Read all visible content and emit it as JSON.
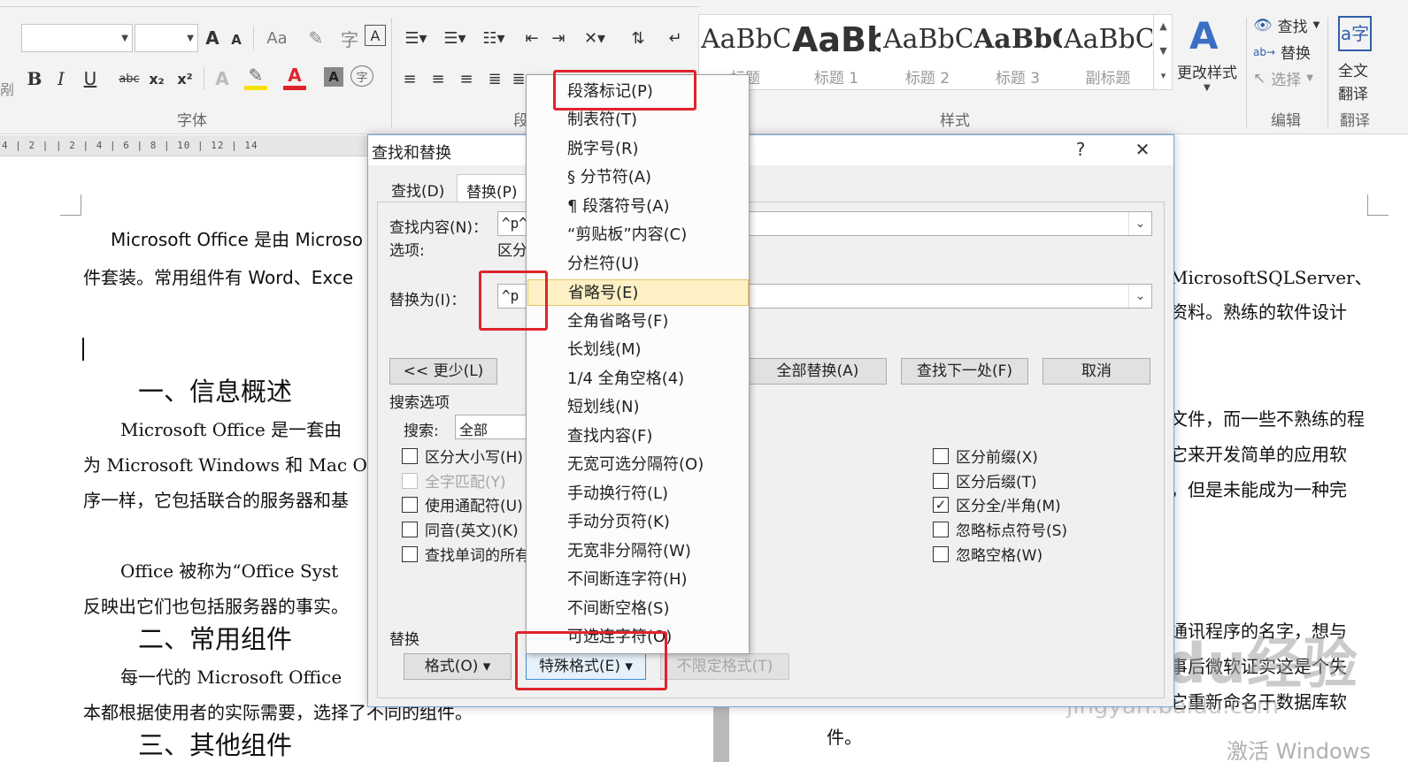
{
  "ribbon": {
    "font_group_label": "字体",
    "para_group_label": "段",
    "styles_group_label": "样式",
    "edit_group_label": "编辑",
    "translate_group_label": "翻译",
    "font_buttons": {
      "grow": "A",
      "shrink": "A",
      "aa": "Aa",
      "bold": "B",
      "italic": "I",
      "underline": "U",
      "strike": "abc",
      "sub": "x₂",
      "sup": "x²",
      "font_color": "A",
      "char_shade": "A",
      "enclose": "字"
    },
    "styles": [
      {
        "sample": "AaBbC",
        "name": "标题"
      },
      {
        "sample": "AaBb",
        "name": "标题 1"
      },
      {
        "sample": "AaBbC",
        "name": "标题 2"
      },
      {
        "sample": "AaBbC",
        "name": "标题 3"
      },
      {
        "sample": "AaBbC",
        "name": "副标题"
      }
    ],
    "change_styles": "更改样式",
    "find": "查找",
    "replace": "替换",
    "select": "选择",
    "translate_line1": "全文",
    "translate_line2": "翻译",
    "left_edge": "剐"
  },
  "ruler": {
    "text": "4 | 2 |    | 2 | 4 | 6 | 8 | 10 | 12 | 14"
  },
  "document": {
    "line1": "Microsoft  Office  是由 Microso",
    "line2": "件套装。常用组件有  Word、Exce",
    "line1_right": "MicrosoftSQLServer、",
    "line2_right": "资料。熟练的软件设计",
    "heading1": "一、信息概述",
    "p2_l1": "Microsoft  Office  是一套由",
    "p2_l2": "为 Microsoft  Windows  和  Mac  O",
    "p2_l3": "序一样，它包括联合的服务器和基",
    "p2_r1": "文件，而一些不熟练的程",
    "p2_r2": "它来开发简单的应用软",
    "p2_r3": "，但是未能成为一种完",
    "p3_l1": "Office  被称为“Office Syst",
    "p3_l2": "反映出它们也包括服务器的事实。",
    "heading2": "二、常用组件",
    "p4_l1": "每一代的 Microsoft Office",
    "p4_l2": "本都根据使用者的实际需要，选择了不同的组件。",
    "p4_r1": "通讯程序的名字，想与",
    "p4_r2": "事后微软证实这是个失",
    "p4_r3": "它重新命名于数据库软",
    "p4_r4": "件。",
    "heading3": "三、其他组件",
    "activate": "激活 Windows"
  },
  "dialog": {
    "title": "查找和替换",
    "help": "?",
    "close": "✕",
    "tab_find": "查找(D)",
    "tab_replace": "替换(P)",
    "find_label": "查找内容(N)：",
    "find_value": "^p^",
    "options_label": "选项:",
    "options_value": "区分",
    "replace_label": "替换为(I)：",
    "replace_value": "^p",
    "less_button": "<< 更少(L)",
    "replace_all": "全部替换(A)",
    "find_next": "查找下一处(F)",
    "cancel": "取消",
    "search_options": "搜索选项",
    "search_label": "搜索:",
    "search_value": "全部",
    "checks_left": [
      {
        "label": "区分大小写(H)",
        "checked": "",
        "disabled": false
      },
      {
        "label": "全字匹配(Y)",
        "checked": "",
        "disabled": true
      },
      {
        "label": "使用通配符(U)",
        "checked": "",
        "disabled": false
      },
      {
        "label": "同音(英文)(K)",
        "checked": "",
        "disabled": false
      },
      {
        "label": "查找单词的所有",
        "checked": "",
        "disabled": false
      }
    ],
    "checks_right": [
      {
        "label": "区分前缀(X)",
        "checked": ""
      },
      {
        "label": "区分后缀(T)",
        "checked": ""
      },
      {
        "label": "区分全/半角(M)",
        "checked": "✓"
      },
      {
        "label": "忽略标点符号(S)",
        "checked": ""
      },
      {
        "label": "忽略空格(W)",
        "checked": ""
      }
    ],
    "replace_section": "替换",
    "format_button": "格式(O) ▾",
    "special_button": "特殊格式(E) ▾",
    "no_format_button": "不限定格式(T)"
  },
  "special_menu": [
    "段落标记(P)",
    "制表符(T)",
    "脱字号(R)",
    "§ 分节符(A)",
    "¶ 段落符号(A)",
    "“剪贴板”内容(C)",
    "分栏符(U)",
    "省略号(E)",
    "全角省略号(F)",
    "长划线(M)",
    "1/4 全角空格(4)",
    "短划线(N)",
    "查找内容(F)",
    "无宽可选分隔符(O)",
    "手动换行符(L)",
    "手动分页符(K)",
    "无宽非分隔符(W)",
    "不间断连字符(H)",
    "不间断空格(S)",
    "可选连字符(O)"
  ],
  "watermark": {
    "big": "Baidu经验",
    "small": "jingyan.baidu.com"
  }
}
